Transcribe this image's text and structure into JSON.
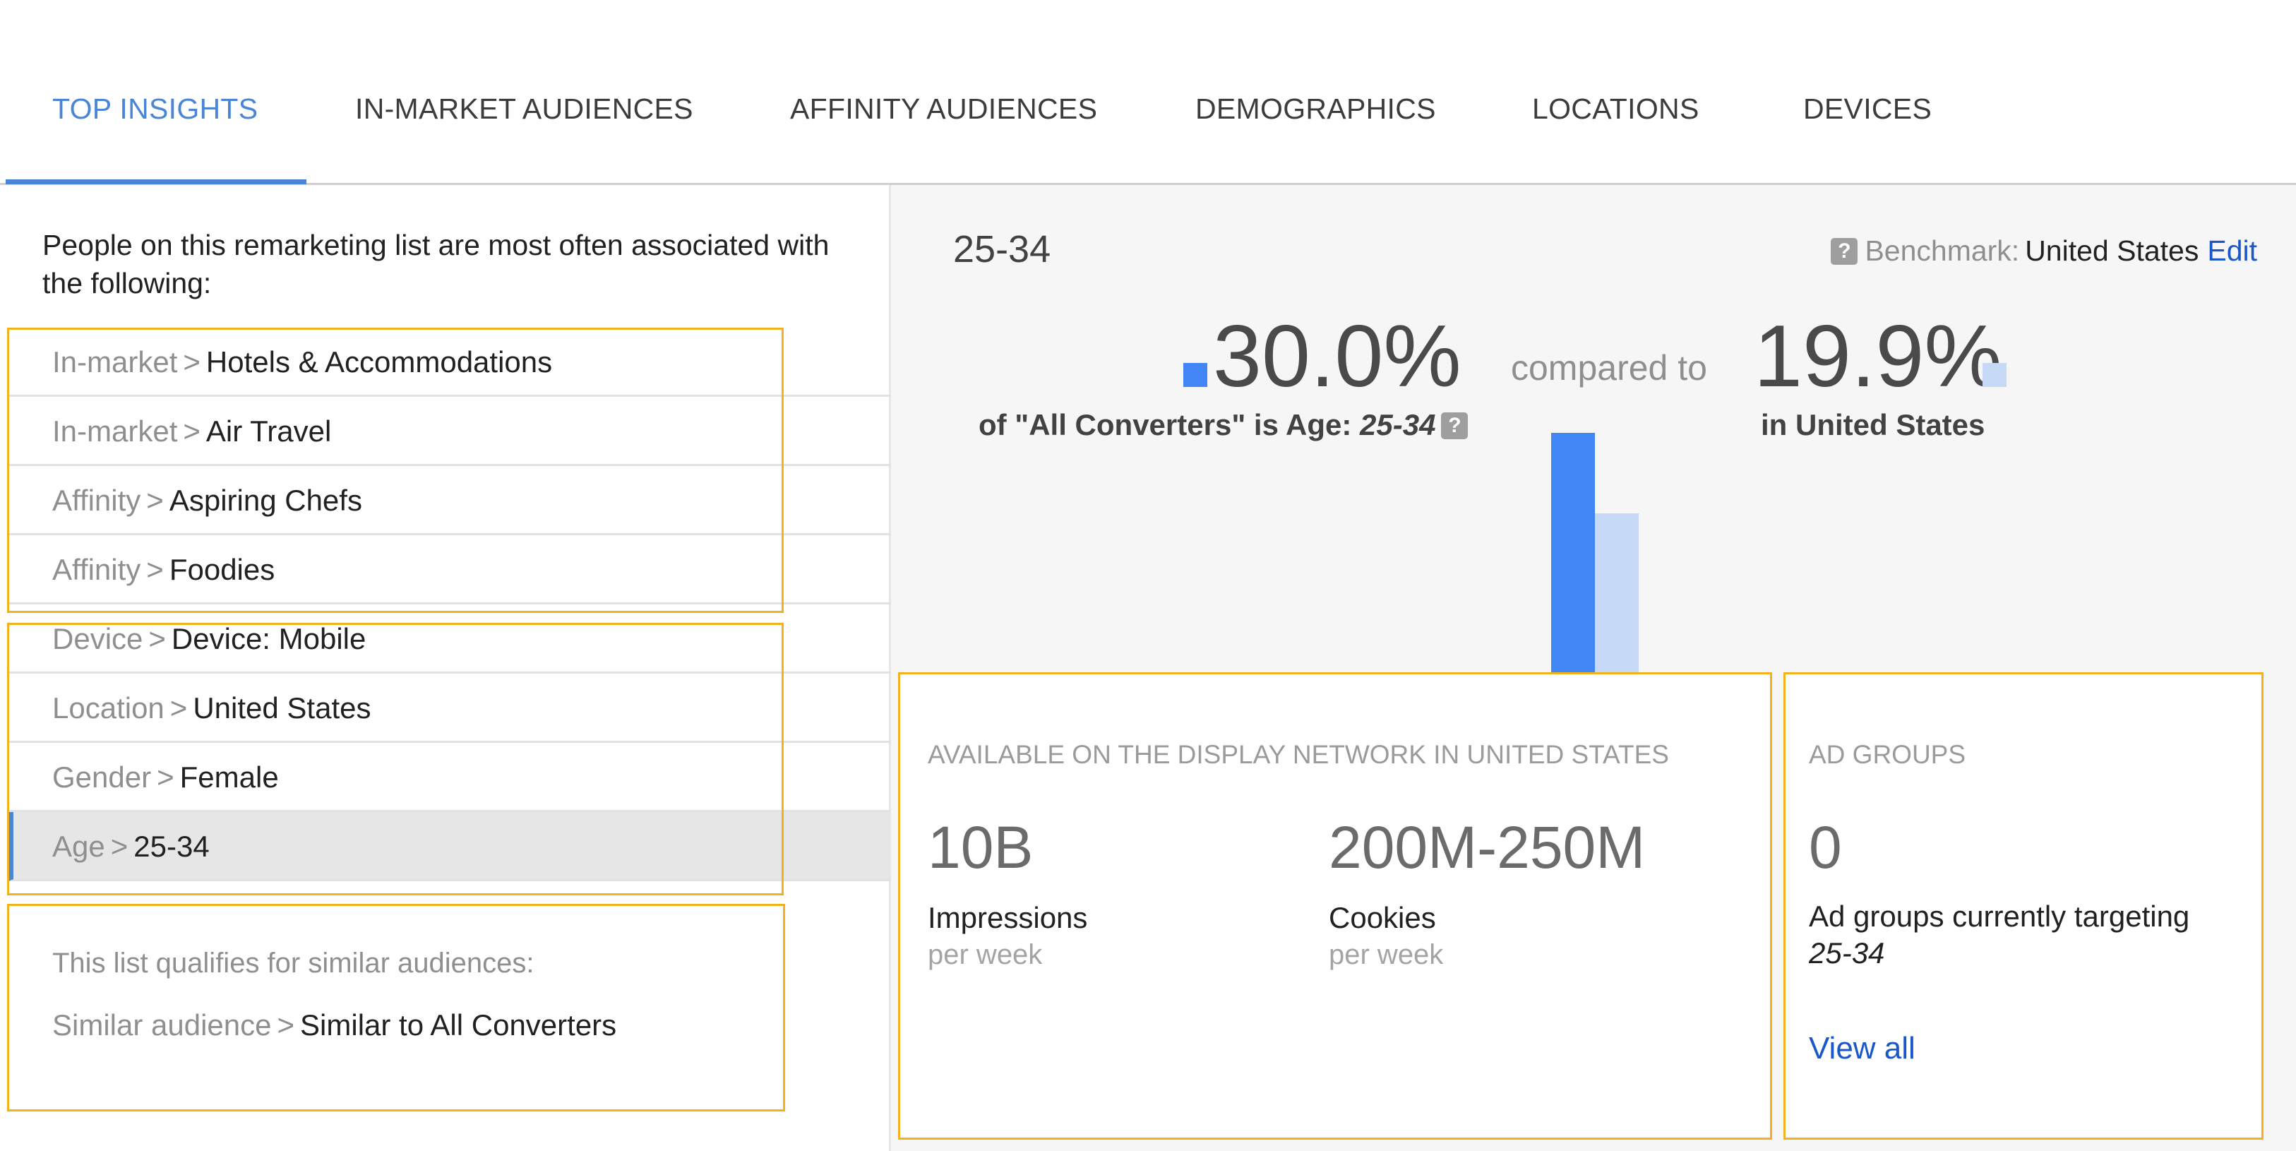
{
  "tabs": [
    {
      "label": "TOP INSIGHTS",
      "active": true
    },
    {
      "label": "IN-MARKET AUDIENCES",
      "active": false
    },
    {
      "label": "AFFINITY AUDIENCES",
      "active": false
    },
    {
      "label": "DEMOGRAPHICS",
      "active": false
    },
    {
      "label": "LOCATIONS",
      "active": false
    },
    {
      "label": "DEVICES",
      "active": false
    }
  ],
  "left": {
    "intro": "People on this remarketing list are most often associated with the following:",
    "separator": ">",
    "insights": [
      {
        "category": "In-market",
        "value": "Hotels & Accommodations"
      },
      {
        "category": "In-market",
        "value": "Air Travel"
      },
      {
        "category": "Affinity",
        "value": "Aspiring Chefs"
      },
      {
        "category": "Affinity",
        "value": "Foodies"
      },
      {
        "category": "Device",
        "value": "Device: Mobile"
      },
      {
        "category": "Location",
        "value": "United States"
      },
      {
        "category": "Gender",
        "value": "Female"
      },
      {
        "category": "Age",
        "value": "25-34",
        "selected": true
      }
    ],
    "qualify_text": "This list qualifies for similar audiences:",
    "similar": {
      "category": "Similar audience",
      "value": "Similar to All Converters"
    }
  },
  "detail": {
    "title": "25-34",
    "help_icon": "?",
    "benchmark_label": "Benchmark:",
    "benchmark_value": "United States",
    "edit_label": "Edit",
    "audience_pct": "30.0%",
    "audience_desc_prefix": "of \"All Converters\" is Age:",
    "audience_desc_value": "25-34",
    "compared_to": "compared to",
    "benchmark_pct": "19.9%",
    "benchmark_desc": "in United States",
    "bar_values": {
      "audience": 30.0,
      "benchmark": 19.9
    },
    "colors": {
      "audience": "#4285f4",
      "benchmark": "#c6daf8",
      "accent": "#4a86d8",
      "link": "#1a57c8",
      "highlight": "#f2b21f"
    }
  },
  "availability": {
    "heading": "AVAILABLE ON THE DISPLAY NETWORK IN UNITED STATES",
    "impressions_value": "10B",
    "impressions_label": "Impressions",
    "impressions_period": "per week",
    "cookies_value": "200M-250M",
    "cookies_label": "Cookies",
    "cookies_period": "per week"
  },
  "ad_groups": {
    "heading": "AD GROUPS",
    "count": "0",
    "desc": "Ad groups currently targeting",
    "desc_value": "25-34",
    "view_all": "View all"
  }
}
